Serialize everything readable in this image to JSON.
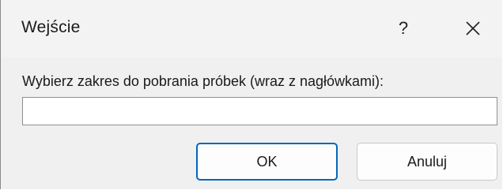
{
  "window": {
    "title": "Wejście",
    "help_label": "?",
    "close_icon": "close-icon"
  },
  "form": {
    "prompt": "Wybierz zakres do pobrania próbek (wraz z nagłówkami):",
    "range_value": ""
  },
  "buttons": {
    "ok_label": "OK",
    "cancel_label": "Anuluj"
  },
  "colors": {
    "accent": "#0067c0",
    "background": "#f0f0f0"
  }
}
